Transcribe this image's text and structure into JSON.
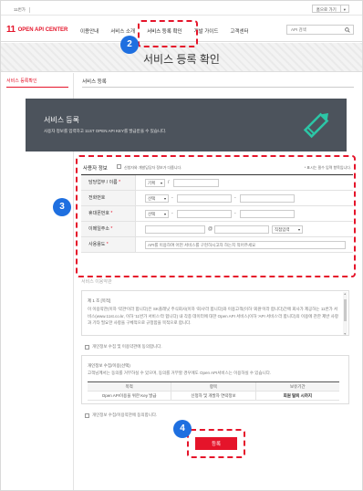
{
  "topbar": {
    "family_label": "11번가",
    "home_label": "홈으로 가기",
    "home_arrow": "▾"
  },
  "logo": {
    "mark": "11",
    "text": "OPEN API CENTER"
  },
  "gnb": {
    "menu": [
      "이용안내",
      "서비스 소개",
      "서비스 등록 확인",
      "개발 가이드",
      "고객센터"
    ],
    "search_placeholder": "API 검색"
  },
  "hero": {
    "title": "서비스 등록 확인"
  },
  "lnb": {
    "item": "서비스 등록확인"
  },
  "content": {
    "breadcrumb": "서비스 등록"
  },
  "banner": {
    "title": "서비스 등록",
    "desc": "사용자 정보를 입력하고 11ST OPEN API KEY를 발급받을 수 있습니다."
  },
  "form": {
    "section_title": "사용자 정보",
    "same_as_signup": "신청자와 개발담당자 정보가 다릅니다.",
    "required_note": "* 표시는 필수 입력 항목입니다.",
    "fields": {
      "manager_label": "담당업무 / 이름",
      "manager_select": "기획",
      "manager_slash": "/",
      "phone_label": "전화번호",
      "phone_select": "선택",
      "mobile_label": "휴대폰번호",
      "mobile_select": "선택",
      "email_label": "이메일주소",
      "email_at": "@",
      "email_select": "직접입력",
      "usage_label": "사용용도",
      "usage_value": "API를 이용하여 어떤 서비스를 구현하시고자 하는지 적어주세요"
    },
    "dash": "-",
    "star": "*",
    "dropdown_arrow": "▾"
  },
  "terms": {
    "title": "서비스 이용약관",
    "heading": "제 1 조 [목적]",
    "body": "이 이용약관(이하 '약관'이라 합니다)은 SK플래닛 주식회사(이하 '회사'라 합니다)와 이용고객(이하 '회원'이라 합니다)간에 회사가 제공하는 11번가 서비스(www.11st.co.kr, 이하 '11번가 서비스'라 합니다) 내 각종 데이터에 대한 Open API 서비스(이하 'API 서비스'라 합니다)의 이용에 관한 제반 사항과 기타 필요한 사항을 구체적으로 규정함을 목적으로 합니다.",
    "agree": "개인정보 수집 및 이용약관에 동의합니다.",
    "scroll_up": "▲",
    "scroll_down": "▼"
  },
  "privacy": {
    "heading": "개인정보 수집/이용(선택)",
    "body": "고객님께서는 동의를 거부하실 수 있으며, 동의를 거부할 경우에도 Open API서비스는 이용하실 수 있습니다.",
    "columns": [
      "목적",
      "항목",
      "보유기간"
    ],
    "row": [
      "Open API이용을 위한 Key 발급",
      "신청자 및 개발자 연락정보",
      "회원 탈퇴 시까지"
    ],
    "agree": "개인정보 수집/이용약관에 동의합니다."
  },
  "submit": {
    "label": "등록"
  },
  "callouts": [
    "2",
    "3",
    "4"
  ],
  "colors": {
    "accent": "#e5142a",
    "badge": "#1e6fe0",
    "banner": "#4c535c",
    "pen": "#2cc6a6"
  }
}
